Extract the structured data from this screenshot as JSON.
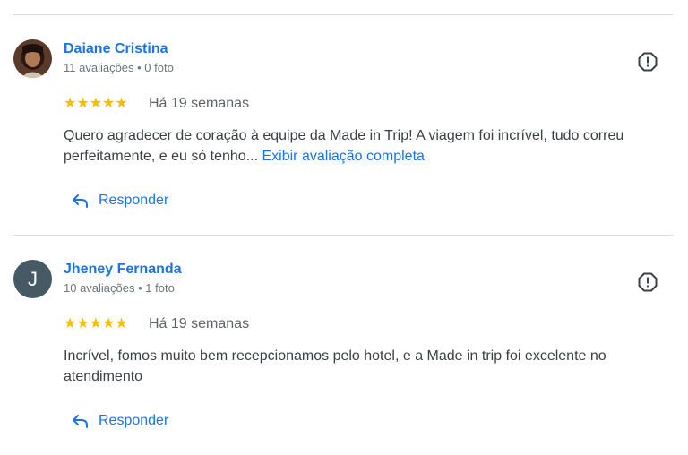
{
  "reviews": [
    {
      "author": "Daiane Cristina",
      "meta": "11 avaliações • 0 foto",
      "stars": "★★★★★",
      "time": "Há 19 semanas",
      "text": "Quero agradecer de coração à equipe da Made in Trip! A viagem foi incrível, tudo correu perfeitamente, e eu só tenho...",
      "more": "Exibir avaliação completa",
      "reply_label": "Responder",
      "avatar_type": "photo"
    },
    {
      "author": "Jheney Fernanda",
      "meta": "10 avaliações • 1 foto",
      "stars": "★★★★★",
      "time": "Há 19 semanas",
      "text": "Incrível, fomos muito bem recepcionamos pelo hotel, e a Made in trip foi excelente no atendimento",
      "more": "",
      "reply_label": "Responder",
      "avatar_type": "initial",
      "avatar_initial": "J"
    }
  ],
  "rating": 5,
  "colors": {
    "link": "#1a73e8",
    "star": "#fbbc04",
    "avatar_bg": "#465a65",
    "divider": "#dadce0"
  },
  "icons": [
    "report-flag-icon",
    "reply-arrow-icon",
    "star-icon"
  ]
}
